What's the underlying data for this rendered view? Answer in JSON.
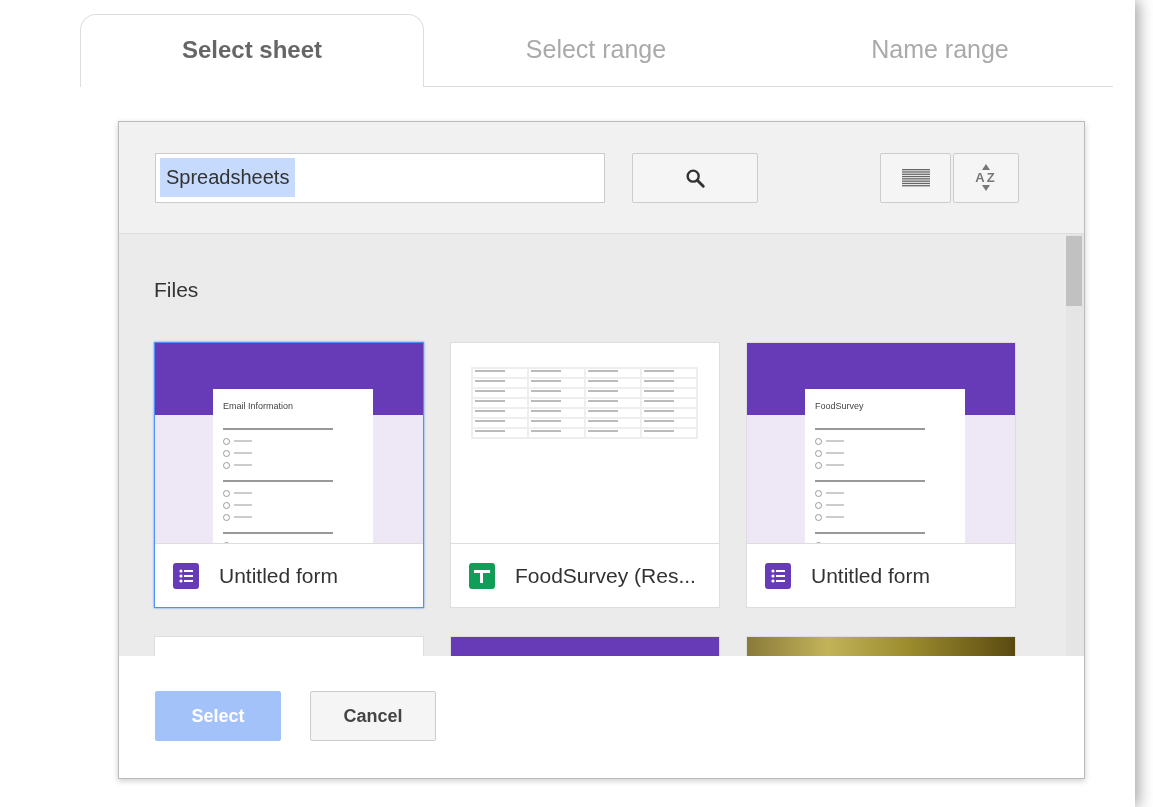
{
  "tabs": [
    {
      "label": "Select sheet",
      "selected": true
    },
    {
      "label": "Select range",
      "selected": false
    },
    {
      "label": "Name range",
      "selected": false
    }
  ],
  "search": {
    "value": "Spreadsheets",
    "highlighted": true
  },
  "toolbar": {
    "sort_label": "AZ"
  },
  "section_title": "Files",
  "files": [
    {
      "kind": "form",
      "name": "Untitled form",
      "selected": true,
      "preview_title": "Email Information"
    },
    {
      "kind": "sheet",
      "name": "FoodSurvey (Res...",
      "selected": false
    },
    {
      "kind": "form",
      "name": "Untitled form",
      "selected": false,
      "preview_title": "FoodSurvey"
    },
    {
      "kind": "blank",
      "selected": false
    },
    {
      "kind": "form",
      "selected": false
    },
    {
      "kind": "photo",
      "selected": false
    }
  ],
  "buttons": [
    {
      "label": "Select",
      "disabled": true
    },
    {
      "label": "Cancel",
      "disabled": false
    }
  ]
}
